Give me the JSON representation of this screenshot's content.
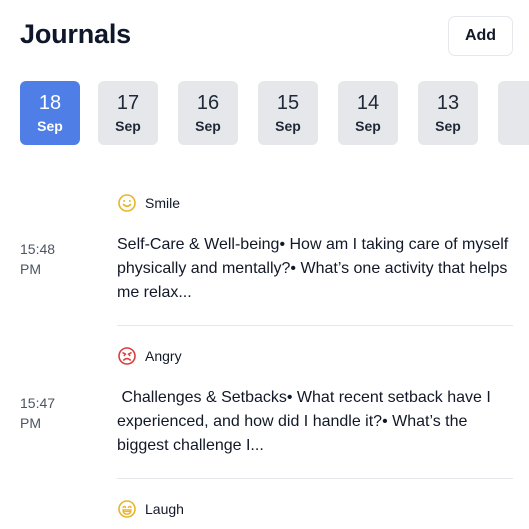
{
  "header": {
    "title": "Journals",
    "add_label": "Add"
  },
  "colors": {
    "accent": "#4f7fe6",
    "smile": "#e7b52b",
    "angry": "#dc3c3c",
    "laugh": "#e7b52b"
  },
  "dates": [
    {
      "day": "18",
      "month": "Sep",
      "active": true
    },
    {
      "day": "17",
      "month": "Sep",
      "active": false
    },
    {
      "day": "16",
      "month": "Sep",
      "active": false
    },
    {
      "day": "15",
      "month": "Sep",
      "active": false
    },
    {
      "day": "14",
      "month": "Sep",
      "active": false
    },
    {
      "day": "13",
      "month": "Sep",
      "active": false
    }
  ],
  "entries": [
    {
      "mood_icon": "smile-face-icon",
      "mood": "Smile",
      "time_line1": "15:48",
      "time_line2": "PM",
      "text": "Self-Care & Well-being• How am I taking care of myself physically and mentally?• What’s one activity that helps me relax..."
    },
    {
      "mood_icon": "angry-face-icon",
      "mood": "Angry",
      "time_line1": "15:47",
      "time_line2": "PM",
      "text": " Challenges & Setbacks• What recent setback have I experienced, and how did I handle it?• What’s the biggest challenge I..."
    },
    {
      "mood_icon": "laugh-face-icon",
      "mood": "Laugh"
    }
  ]
}
